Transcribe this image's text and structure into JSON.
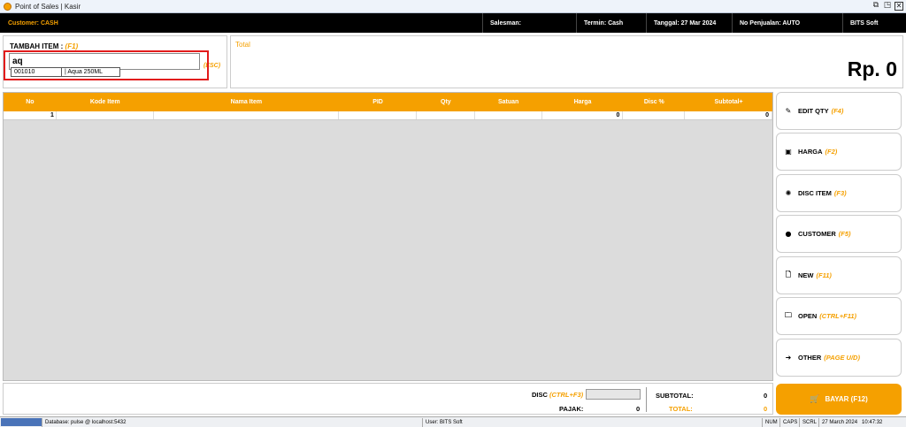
{
  "window": {
    "title": "Point of Sales | Kasir",
    "controls": [
      "restore-icon",
      "maximize-icon",
      "close-icon"
    ]
  },
  "infobar": {
    "customer": "Customer: CASH",
    "salesman": "Salesman:",
    "termin": "Termin: Cash",
    "tanggal": "Tanggal: 27 Mar 2024",
    "no_penjualan": "No Penjualan: AUTO",
    "company": "BITS Soft"
  },
  "tambah": {
    "label": "TAMBAH ITEM :",
    "key": "(F1)",
    "input_value": "aq",
    "esc": "(ESC)",
    "suggestion": {
      "code": "001010",
      "name": "| Aqua 250ML"
    }
  },
  "total": {
    "label": "Total",
    "value": "Rp. 0"
  },
  "grid": {
    "columns": [
      "No",
      "Kode Item",
      "Nama Item",
      "PID",
      "Qty",
      "Satuan",
      "Harga",
      "Disc %",
      "Subtotal+"
    ],
    "rows": [
      {
        "no": "1",
        "kode": "",
        "nama": "",
        "pid": "",
        "qty": "",
        "satuan": "",
        "harga": "0",
        "disc": "",
        "subtotal": "0"
      }
    ]
  },
  "side_buttons": [
    {
      "label": "EDIT QTY",
      "key": "(F4)",
      "icon": "edit-icon"
    },
    {
      "label": "HARGA",
      "key": "(F2)",
      "icon": "money-icon"
    },
    {
      "label": "DISC ITEM",
      "key": "(F3)",
      "icon": "discount-icon"
    },
    {
      "label": "CUSTOMER",
      "key": "(F5)",
      "icon": "person-icon"
    },
    {
      "label": "NEW",
      "key": "(F11)",
      "icon": "new-file-icon"
    },
    {
      "label": "OPEN",
      "key": "(CTRL+F11)",
      "icon": "folder-icon"
    },
    {
      "label": "OTHER",
      "key": "(PAGE U/D)",
      "icon": "arrow-right-icon"
    }
  ],
  "summary": {
    "disc_label": "DISC",
    "disc_key": "(CTRL+F3)",
    "pajak_label": "PAJAK:",
    "pajak_value": "0",
    "subtotal_label": "SUBTOTAL:",
    "subtotal_value": "0",
    "total_label": "TOTAL:",
    "total_value": "0"
  },
  "bayar": {
    "label": "BAYAR (F12)",
    "icon": "cart-icon"
  },
  "statusbar": {
    "database": "Database: pulse @ localhost:5432",
    "user": "User: BITS Soft",
    "num": "NUM",
    "caps": "CAPS",
    "scrl": "SCRL",
    "datetime": "27 March 2024   10:47:32"
  },
  "colors": {
    "accent": "#f5a000",
    "highlight": "#e21b1b",
    "infobar": "#000000"
  }
}
